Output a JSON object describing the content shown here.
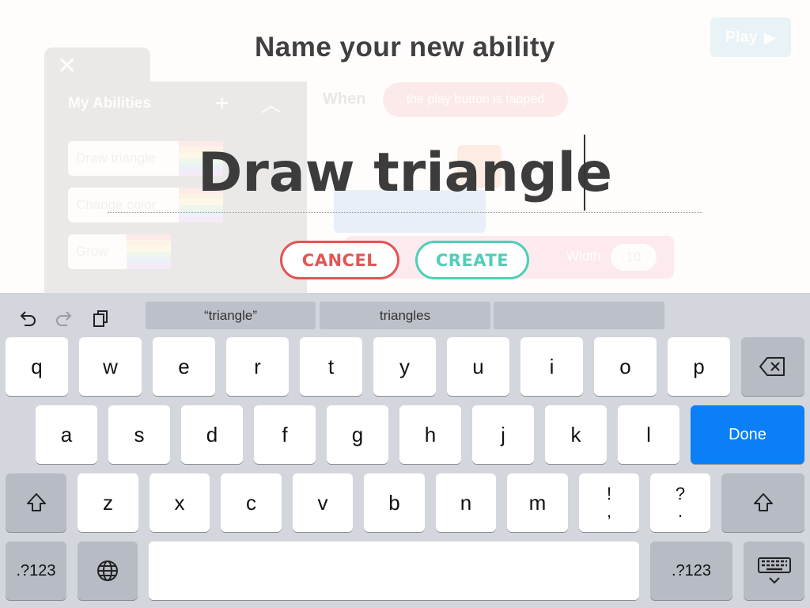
{
  "background": {
    "play_label": "Play",
    "sidebar_title": "My Abilities",
    "abilities": [
      "Draw triangle",
      "Change color",
      "Grow"
    ],
    "when_label": "When",
    "trigger_label": "the play button is tapped",
    "width_label": "Width",
    "width_value": "10"
  },
  "dialog": {
    "title": "Name your new ability",
    "name_value": "Draw triangle",
    "cancel_label": "CANCEL",
    "create_label": "CREATE"
  },
  "keyboard": {
    "suggestions": [
      "“triangle”",
      "triangles",
      ""
    ],
    "row1": [
      "q",
      "w",
      "e",
      "r",
      "t",
      "y",
      "u",
      "i",
      "o",
      "p"
    ],
    "row2": [
      "a",
      "s",
      "d",
      "f",
      "g",
      "h",
      "j",
      "k",
      "l"
    ],
    "row3": [
      "z",
      "x",
      "c",
      "v",
      "b",
      "n",
      "m"
    ],
    "punct1": [
      "!",
      ","
    ],
    "punct2": [
      "?",
      "."
    ],
    "done_label": "Done",
    "numbers_label": ".?123",
    "icons": {
      "undo": "undo-icon",
      "redo": "redo-icon",
      "paste": "paste-icon",
      "backspace": "backspace-icon",
      "shift": "shift-icon",
      "globe": "globe-icon",
      "dismiss": "keyboard-dismiss-icon"
    }
  }
}
